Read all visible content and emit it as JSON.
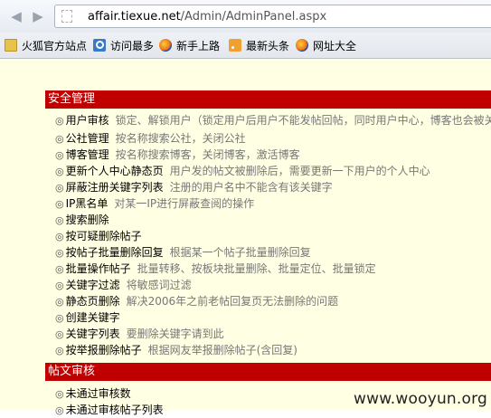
{
  "browser": {
    "url_domain": "affair.tiexue.net",
    "url_path": "/Admin/AdminPanel.aspx",
    "bookmarks": [
      {
        "label": "火狐官方站点",
        "icon": "folder-icon"
      },
      {
        "label": "访问最多",
        "icon": "search-icon"
      },
      {
        "label": "新手上路",
        "icon": "firefox-icon"
      },
      {
        "label": "最新头条",
        "icon": "rss-icon"
      },
      {
        "label": "网址大全",
        "icon": "firefox-icon"
      }
    ]
  },
  "sections": [
    {
      "title": "安全管理",
      "items": [
        {
          "bullet": "◎",
          "label": "用户审核",
          "desc": "锁定、解锁用户（锁定用户后用户不能发帖回帖，同时用户中心，博客也会被关闭"
        },
        {
          "bullet": "◎",
          "label": "公社管理",
          "desc": "按名称搜索公社，关闭公社"
        },
        {
          "bullet": "◎",
          "label": "博客管理",
          "desc": "按名称搜索博客，关闭博客，激活博客"
        },
        {
          "bullet": "◎",
          "label": "更新个人中心静态页",
          "desc": "用户发的帖文被删除后，需要更新一下用户的个人中心"
        },
        {
          "bullet": "◎",
          "label": "屏蔽注册关键字列表",
          "desc": "注册的用户名中不能含有该关键字"
        },
        {
          "bullet": "◎",
          "label": "IP黑名单",
          "desc": "对某一IP进行屏蔽查阅的操作"
        },
        {
          "bullet": "◎",
          "label": "搜索删除",
          "desc": ""
        },
        {
          "bullet": "◎",
          "label": "按可疑删除帖子",
          "desc": ""
        },
        {
          "bullet": "◎",
          "label": "按帖子批量删除回复",
          "desc": "根据某一个帖子批量删除回复"
        },
        {
          "bullet": "◎",
          "label": "批量操作帖子",
          "desc": "批量转移、按板块批量删除、批量定位、批量锁定"
        },
        {
          "bullet": "◎",
          "label": "关键字过滤",
          "desc": "将敏感词过滤"
        },
        {
          "bullet": "◎",
          "label": "静态页删除",
          "desc": "解决2006年之前老帖回复页无法删除的问题"
        },
        {
          "bullet": "◎",
          "label": "创建关键字",
          "desc": ""
        },
        {
          "bullet": "◎",
          "label": "关键字列表",
          "desc": "要删除关键字请到此"
        },
        {
          "bullet": "◎",
          "label": "按举报删除帖子",
          "desc": "根据网友举报删除帖子(含回复)"
        }
      ]
    },
    {
      "title": "帖文审核",
      "items": [
        {
          "bullet": "◎",
          "label": "未通过审核数",
          "desc": ""
        },
        {
          "bullet": "◎",
          "label": "未通过审核帖子列表",
          "desc": ""
        }
      ]
    }
  ],
  "watermark": "www.wooyun.org"
}
